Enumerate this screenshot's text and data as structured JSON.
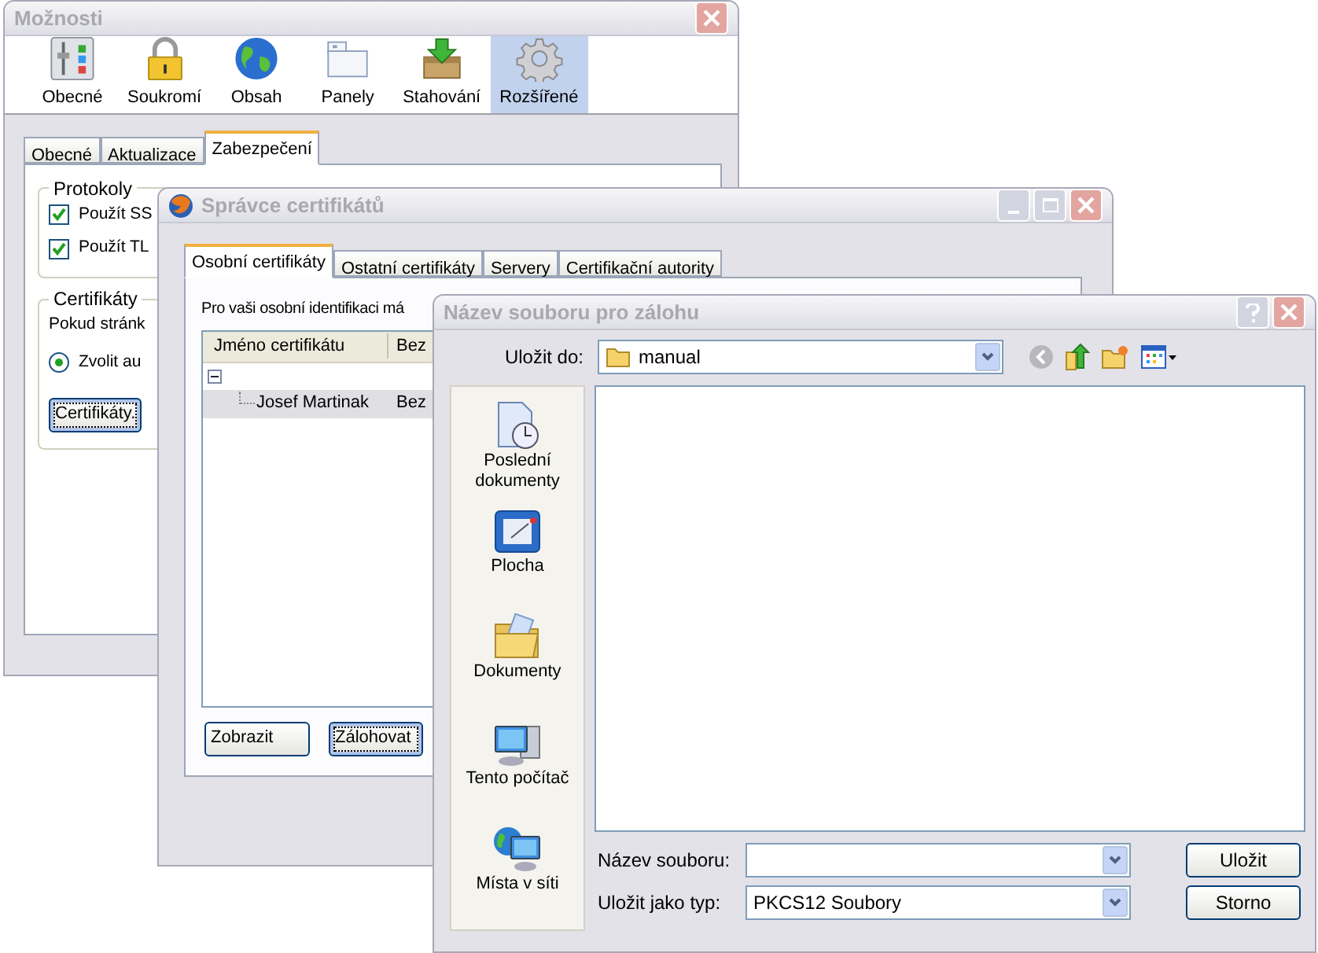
{
  "options_window": {
    "title": "Možnosti",
    "toolbar": [
      {
        "label": "Obecné",
        "selected": false
      },
      {
        "label": "Soukromí",
        "selected": false
      },
      {
        "label": "Obsah",
        "selected": false
      },
      {
        "label": "Panely",
        "selected": false
      },
      {
        "label": "Stahování",
        "selected": false
      },
      {
        "label": "Rozšířené",
        "selected": true
      }
    ],
    "tabs": [
      {
        "label": "Obecné",
        "selected": false
      },
      {
        "label": "Aktualizace",
        "selected": false
      },
      {
        "label": "Zabezpečení",
        "selected": true
      }
    ],
    "groups": [
      {
        "title": "Protokoly",
        "items": [
          {
            "kind": "checkbox",
            "label": "Použít SS",
            "checked": true
          },
          {
            "kind": "checkbox",
            "label": "Použít TL",
            "checked": true
          }
        ]
      },
      {
        "title": "Certifikáty",
        "items": [
          {
            "kind": "text",
            "label": "Pokud stránk"
          },
          {
            "kind": "radio",
            "label": "Zvolit au",
            "selected": true
          },
          {
            "kind": "button",
            "label": "Certifikáty.",
            "focused": true
          }
        ]
      }
    ]
  },
  "cert_manager": {
    "title": "Správce certifikátů",
    "tabs": [
      {
        "label": "Osobní certifikáty",
        "selected": true
      },
      {
        "label": "Ostatní certifikáty",
        "selected": false
      },
      {
        "label": "Servery",
        "selected": false
      },
      {
        "label": "Certifikační autority",
        "selected": false
      }
    ],
    "intro": "Pro vaši osobní identifikaci má",
    "columns": [
      "Jméno certifikátu",
      "Bez"
    ],
    "tree": [
      {
        "expanded": true,
        "children": [
          {
            "name": "Josef Martinak",
            "column_2": "Bez",
            "selected": true
          }
        ]
      }
    ],
    "buttons": [
      {
        "label": "Zobrazit",
        "focused": false
      },
      {
        "label": "Zálohovat",
        "focused": true
      }
    ]
  },
  "save_dialog": {
    "title": "Název souboru pro zálohu",
    "save_in": {
      "label": "Uložit do:",
      "value": "manual"
    },
    "places": [
      "Poslední dokumenty",
      "Plocha",
      "Dokumenty",
      "Tento počítač",
      "Místa v síti"
    ],
    "file_name": {
      "label": "Název souboru:"
    },
    "file_type": {
      "label": "Uložit jako typ:",
      "value": "PKCS12 Soubory"
    },
    "buttons": [
      "Uložit",
      "Storno"
    ]
  }
}
